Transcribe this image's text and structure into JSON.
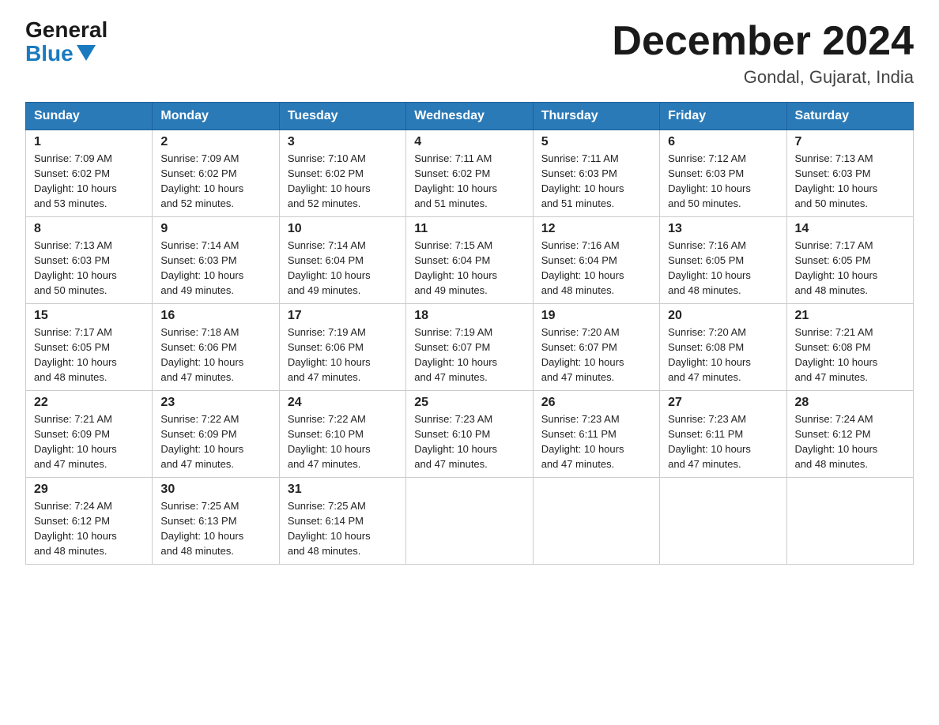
{
  "header": {
    "logo_general": "General",
    "logo_blue": "Blue",
    "month_title": "December 2024",
    "location": "Gondal, Gujarat, India"
  },
  "days_of_week": [
    "Sunday",
    "Monday",
    "Tuesday",
    "Wednesday",
    "Thursday",
    "Friday",
    "Saturday"
  ],
  "weeks": [
    [
      {
        "day": "1",
        "sunrise": "7:09 AM",
        "sunset": "6:02 PM",
        "daylight": "10 hours and 53 minutes."
      },
      {
        "day": "2",
        "sunrise": "7:09 AM",
        "sunset": "6:02 PM",
        "daylight": "10 hours and 52 minutes."
      },
      {
        "day": "3",
        "sunrise": "7:10 AM",
        "sunset": "6:02 PM",
        "daylight": "10 hours and 52 minutes."
      },
      {
        "day": "4",
        "sunrise": "7:11 AM",
        "sunset": "6:02 PM",
        "daylight": "10 hours and 51 minutes."
      },
      {
        "day": "5",
        "sunrise": "7:11 AM",
        "sunset": "6:03 PM",
        "daylight": "10 hours and 51 minutes."
      },
      {
        "day": "6",
        "sunrise": "7:12 AM",
        "sunset": "6:03 PM",
        "daylight": "10 hours and 50 minutes."
      },
      {
        "day": "7",
        "sunrise": "7:13 AM",
        "sunset": "6:03 PM",
        "daylight": "10 hours and 50 minutes."
      }
    ],
    [
      {
        "day": "8",
        "sunrise": "7:13 AM",
        "sunset": "6:03 PM",
        "daylight": "10 hours and 50 minutes."
      },
      {
        "day": "9",
        "sunrise": "7:14 AM",
        "sunset": "6:03 PM",
        "daylight": "10 hours and 49 minutes."
      },
      {
        "day": "10",
        "sunrise": "7:14 AM",
        "sunset": "6:04 PM",
        "daylight": "10 hours and 49 minutes."
      },
      {
        "day": "11",
        "sunrise": "7:15 AM",
        "sunset": "6:04 PM",
        "daylight": "10 hours and 49 minutes."
      },
      {
        "day": "12",
        "sunrise": "7:16 AM",
        "sunset": "6:04 PM",
        "daylight": "10 hours and 48 minutes."
      },
      {
        "day": "13",
        "sunrise": "7:16 AM",
        "sunset": "6:05 PM",
        "daylight": "10 hours and 48 minutes."
      },
      {
        "day": "14",
        "sunrise": "7:17 AM",
        "sunset": "6:05 PM",
        "daylight": "10 hours and 48 minutes."
      }
    ],
    [
      {
        "day": "15",
        "sunrise": "7:17 AM",
        "sunset": "6:05 PM",
        "daylight": "10 hours and 48 minutes."
      },
      {
        "day": "16",
        "sunrise": "7:18 AM",
        "sunset": "6:06 PM",
        "daylight": "10 hours and 47 minutes."
      },
      {
        "day": "17",
        "sunrise": "7:19 AM",
        "sunset": "6:06 PM",
        "daylight": "10 hours and 47 minutes."
      },
      {
        "day": "18",
        "sunrise": "7:19 AM",
        "sunset": "6:07 PM",
        "daylight": "10 hours and 47 minutes."
      },
      {
        "day": "19",
        "sunrise": "7:20 AM",
        "sunset": "6:07 PM",
        "daylight": "10 hours and 47 minutes."
      },
      {
        "day": "20",
        "sunrise": "7:20 AM",
        "sunset": "6:08 PM",
        "daylight": "10 hours and 47 minutes."
      },
      {
        "day": "21",
        "sunrise": "7:21 AM",
        "sunset": "6:08 PM",
        "daylight": "10 hours and 47 minutes."
      }
    ],
    [
      {
        "day": "22",
        "sunrise": "7:21 AM",
        "sunset": "6:09 PM",
        "daylight": "10 hours and 47 minutes."
      },
      {
        "day": "23",
        "sunrise": "7:22 AM",
        "sunset": "6:09 PM",
        "daylight": "10 hours and 47 minutes."
      },
      {
        "day": "24",
        "sunrise": "7:22 AM",
        "sunset": "6:10 PM",
        "daylight": "10 hours and 47 minutes."
      },
      {
        "day": "25",
        "sunrise": "7:23 AM",
        "sunset": "6:10 PM",
        "daylight": "10 hours and 47 minutes."
      },
      {
        "day": "26",
        "sunrise": "7:23 AM",
        "sunset": "6:11 PM",
        "daylight": "10 hours and 47 minutes."
      },
      {
        "day": "27",
        "sunrise": "7:23 AM",
        "sunset": "6:11 PM",
        "daylight": "10 hours and 47 minutes."
      },
      {
        "day": "28",
        "sunrise": "7:24 AM",
        "sunset": "6:12 PM",
        "daylight": "10 hours and 48 minutes."
      }
    ],
    [
      {
        "day": "29",
        "sunrise": "7:24 AM",
        "sunset": "6:12 PM",
        "daylight": "10 hours and 48 minutes."
      },
      {
        "day": "30",
        "sunrise": "7:25 AM",
        "sunset": "6:13 PM",
        "daylight": "10 hours and 48 minutes."
      },
      {
        "day": "31",
        "sunrise": "7:25 AM",
        "sunset": "6:14 PM",
        "daylight": "10 hours and 48 minutes."
      },
      null,
      null,
      null,
      null
    ]
  ],
  "labels": {
    "sunrise": "Sunrise:",
    "sunset": "Sunset:",
    "daylight": "Daylight:"
  }
}
